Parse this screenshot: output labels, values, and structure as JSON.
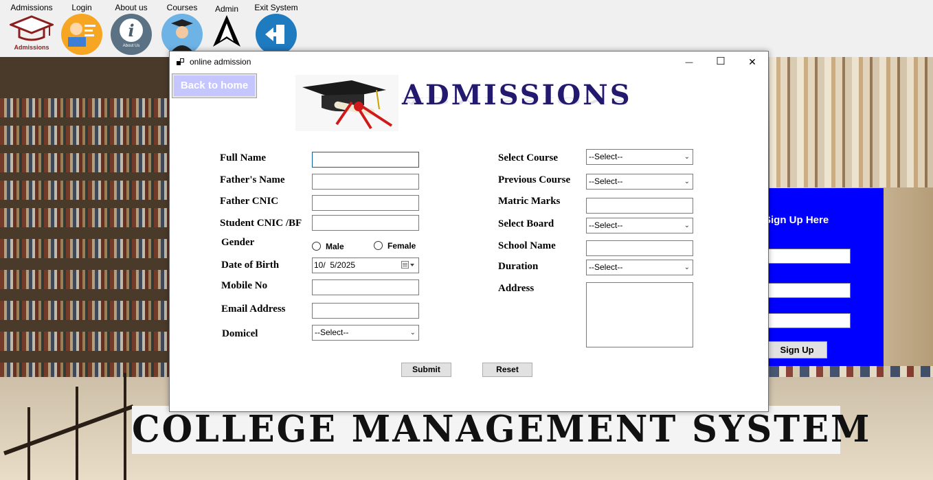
{
  "menu": {
    "items": [
      {
        "label": "Admissions",
        "icon": "graduation-cap-icon",
        "sublabel": "Admissions"
      },
      {
        "label": "Login",
        "icon": "student-reading-icon"
      },
      {
        "label": "About us",
        "icon": "info-icon",
        "sublabel": "About Us"
      },
      {
        "label": "Courses",
        "icon": "graduate-avatar-icon"
      },
      {
        "label": "Admin",
        "icon": "admin-triangle-icon"
      },
      {
        "label": "Exit System",
        "icon": "exit-door-icon"
      }
    ]
  },
  "window": {
    "title": "online admission",
    "controls": {
      "minimize": "—",
      "maximize": "☐",
      "close": "✕"
    }
  },
  "back_home_label": "Back to home",
  "logo_text": "ADMISSIONS",
  "form": {
    "full_name_label": "Full Name",
    "fathers_name_label": "Father's Name",
    "father_cnic_label": "Father CNIC",
    "student_cnic_label": "Student CNIC /BF",
    "gender_label": "Gender",
    "gender_male": "Male",
    "gender_female": "Female",
    "dob_label": "Date of Birth",
    "dob_value": "10/  5/2025",
    "mobile_label": "Mobile No",
    "email_label": "Email Address",
    "domicel_label": "Domicel",
    "domicel_value": "--Select--",
    "course_label": "Select Course",
    "course_value": "--Select--",
    "prev_course_label": "Previous Course",
    "prev_course_value": "--Select--",
    "matric_label": "Matric Marks",
    "board_label": "Select Board",
    "board_value": "--Select--",
    "school_label": "School Name",
    "duration_label": "Duration",
    "duration_value": "--Select--",
    "address_label": "Address",
    "submit_label": "Submit",
    "reset_label": "Reset"
  },
  "signup": {
    "title": "Sign Up Here",
    "button_label": "Sign Up"
  },
  "banner_text": "COLLEGE  MANAGEMENT SYSTEM",
  "colors": {
    "signup_panel": "#0000ff",
    "logo_text": "#23196e",
    "back_home_bg": "#c5c5ff"
  }
}
